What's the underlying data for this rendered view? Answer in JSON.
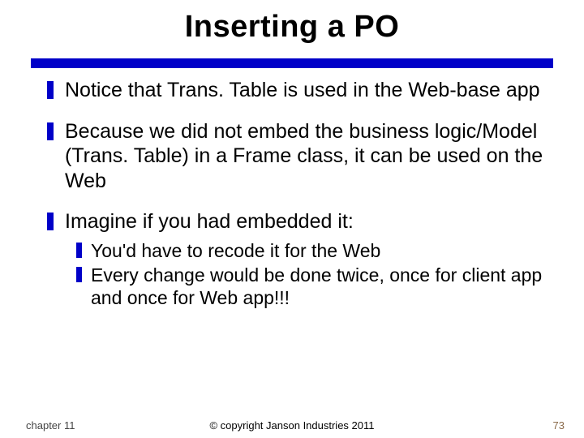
{
  "title": "Inserting a PO",
  "bullets": [
    {
      "text": "Notice that Trans. Table is used in the Web-base app"
    },
    {
      "text": "Because we did not embed the business logic/Model (Trans. Table) in a Frame class, it can be used on the Web"
    },
    {
      "text": "Imagine if you had embedded it:",
      "children": [
        "You'd have to recode it for the Web",
        "Every change would be done twice, once for client app and once for Web app!!!"
      ]
    }
  ],
  "footer": {
    "chapter": "chapter 11",
    "copyright": "© copyright Janson Industries 2011",
    "page": "73"
  }
}
